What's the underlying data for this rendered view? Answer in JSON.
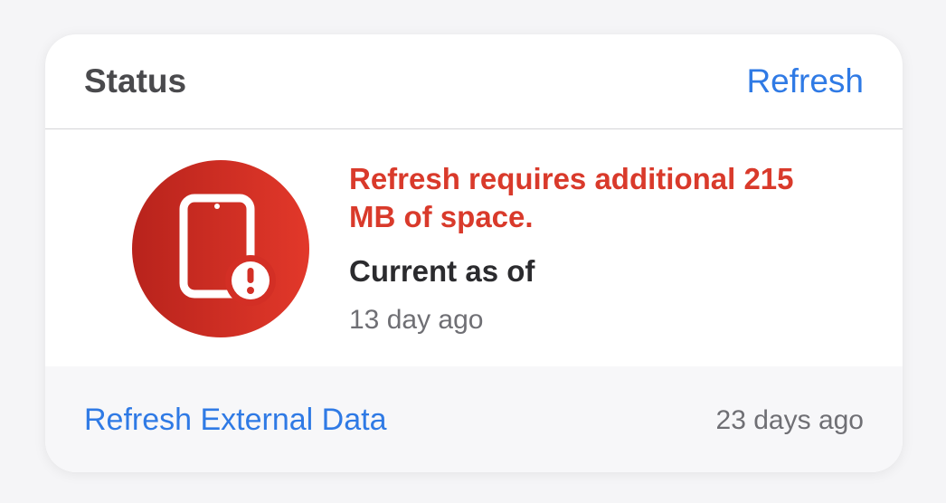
{
  "header": {
    "title": "Status",
    "refresh_label": "Refresh"
  },
  "status": {
    "icon": "device-alert-icon",
    "message": "Refresh requires additional 215 MB of space.",
    "current_label": "Current as of",
    "current_value": "13 day ago",
    "alert_color": "#d93a2b"
  },
  "footer": {
    "link_label": "Refresh External Data",
    "time": "23 days ago"
  },
  "colors": {
    "accent": "#2f7ae5",
    "alert": "#d93a2b"
  }
}
